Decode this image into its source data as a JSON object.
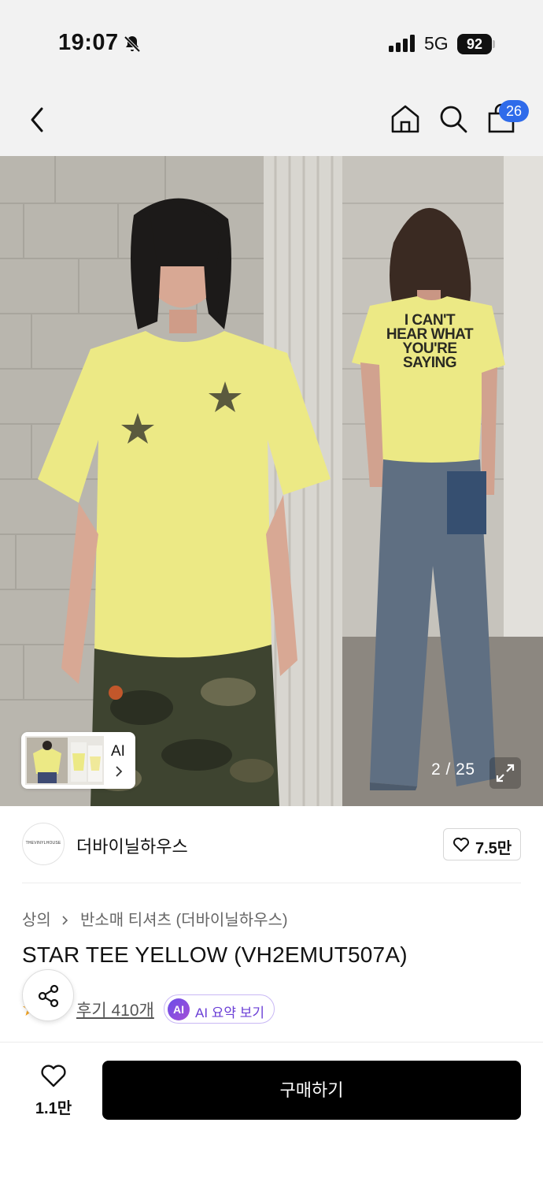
{
  "status_bar": {
    "time": "19:07",
    "network": "5G",
    "battery": "92",
    "icons": [
      "bell-off-icon",
      "signal-icon",
      "battery-icon"
    ]
  },
  "nav": {
    "icons": [
      "back-icon",
      "home-icon",
      "search-icon",
      "shopping-bag-icon"
    ],
    "cart_badge": "26"
  },
  "gallery": {
    "ai_chip_label": "AI",
    "counter": "2 / 25",
    "back_print_text": [
      "I CAN'T",
      "HEAR WHAT",
      "YOU'RE",
      "SAYING"
    ]
  },
  "brand": {
    "logo_text": "THEVINYLHOUSE",
    "name": "더바이닐하우스",
    "likes": "7.5만"
  },
  "product": {
    "breadcrumb": [
      "상의",
      "반소매 티셔츠 (더바이닐하우스)"
    ],
    "title": "STAR TEE YELLOW (VH2EMUT507A)",
    "reviews": "후기 410개",
    "ai_summary_badge": "AI",
    "ai_summary_label": "AI 요약 보기"
  },
  "bottom_bar": {
    "wish_count": "1.1만",
    "buy_label": "구매하기"
  },
  "colors": {
    "accent_blue": "#2f6bea",
    "ai_purple": "#6b3fd6",
    "buy_button": "#000000",
    "tee_yellow": "#ece985"
  }
}
